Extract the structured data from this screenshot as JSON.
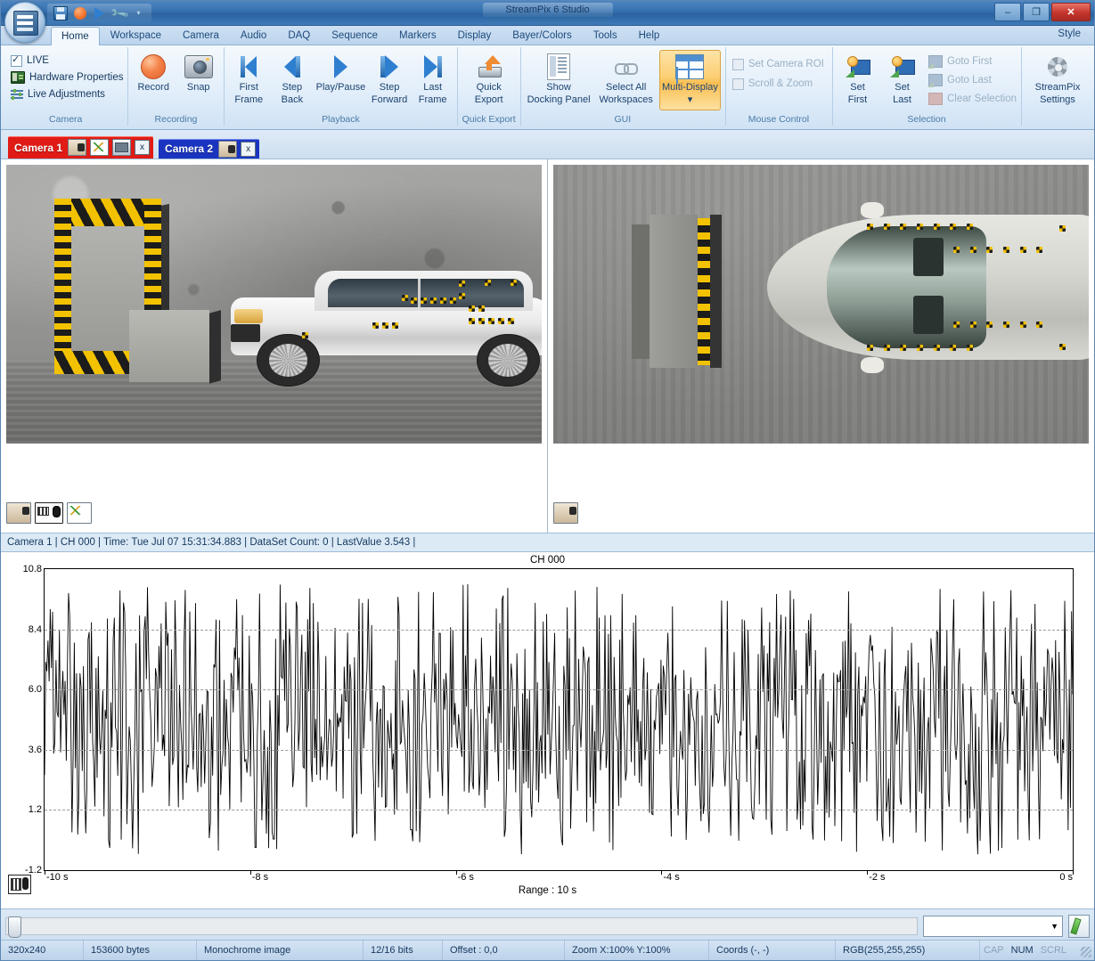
{
  "window": {
    "title": "StreamPix 6 Studio",
    "minimize": "–",
    "maximize": "❐",
    "close": "✕"
  },
  "quick_access": {
    "buttons": [
      {
        "name": "save-icon",
        "glyph": ""
      },
      {
        "name": "record-icon",
        "glyph": ""
      },
      {
        "name": "play-icon",
        "glyph": ""
      },
      {
        "name": "tools-icon",
        "glyph": ""
      },
      {
        "name": "customize-qat-icon",
        "glyph": "▾"
      }
    ]
  },
  "ribbon_tabs": {
    "items": [
      "Home",
      "Workspace",
      "Camera",
      "Audio",
      "DAQ",
      "Sequence",
      "Markers",
      "Display",
      "Bayer/Colors",
      "Tools",
      "Help"
    ],
    "active": "Home",
    "style_label": "Style",
    "style_caret": "▾"
  },
  "ribbon": {
    "groups": [
      {
        "title": "Camera",
        "checks": [
          {
            "label": "LIVE",
            "checked": true,
            "icon": "checkbox"
          },
          {
            "label": "Hardware Properties",
            "checked": false,
            "icon": "hardware-icon"
          },
          {
            "label": "Live Adjustments",
            "checked": false,
            "icon": "adjustments-icon"
          }
        ]
      },
      {
        "title": "Recording",
        "buttons": [
          {
            "label": "Record",
            "icon": "record-circle-icon",
            "active": false,
            "disabled": false
          },
          {
            "label": "Snap",
            "icon": "camera-icon",
            "active": false,
            "disabled": false
          }
        ]
      },
      {
        "title": "Playback",
        "buttons": [
          {
            "label": "First\nFrame",
            "line1": "First",
            "line2": "Frame",
            "icon": "first-frame-icon"
          },
          {
            "label": "Step Back",
            "line1": "Step",
            "line2": "Back",
            "icon": "step-back-icon"
          },
          {
            "label": "Play/Pause",
            "line1": "Play/Pause",
            "line2": "",
            "icon": "play-pause-icon"
          },
          {
            "label": "Step Forward",
            "line1": "Step",
            "line2": "Forward",
            "icon": "step-forward-icon"
          },
          {
            "label": "Last Frame",
            "line1": "Last",
            "line2": "Frame",
            "icon": "last-frame-icon"
          }
        ]
      },
      {
        "title": "Quick Export",
        "buttons": [
          {
            "line1": "Quick",
            "line2": "Export",
            "icon": "export-icon"
          }
        ]
      },
      {
        "title": "GUI",
        "buttons": [
          {
            "line1": "Show",
            "line2": "Docking Panel",
            "icon": "docking-panel-icon"
          },
          {
            "line1": "Select All",
            "line2": "Workspaces",
            "icon": "link-icon"
          },
          {
            "line1": "Multi-Display",
            "line2": "▾",
            "icon": "multi-display-icon",
            "active": true
          }
        ]
      },
      {
        "title": "Mouse Control",
        "checks": [
          {
            "label": "Set Camera ROI",
            "checked": false,
            "disabled": true
          },
          {
            "label": "Scroll & Zoom",
            "checked": false,
            "disabled": true
          }
        ]
      },
      {
        "title": "Selection",
        "buttons": [
          {
            "line1": "Set",
            "line2": "First",
            "icon": "set-first-icon"
          },
          {
            "line1": "Set",
            "line2": "Last",
            "icon": "set-last-icon"
          }
        ],
        "checks": [
          {
            "label": "Goto First",
            "disabled": true,
            "icon": "goto-first-icon"
          },
          {
            "label": "Goto Last",
            "disabled": true,
            "icon": "goto-last-icon"
          },
          {
            "label": "Clear Selection",
            "disabled": true,
            "icon": "clear-selection-icon"
          }
        ]
      },
      {
        "title": "",
        "buttons": [
          {
            "line1": "StreamPix",
            "line2": "Settings",
            "icon": "settings-wrench-icon"
          }
        ]
      }
    ]
  },
  "camera_tabs": [
    {
      "label": "Camera 1",
      "active": true,
      "color": "#e01b15",
      "icons": [
        "camera-icon",
        "graph-icon",
        "display-icon"
      ],
      "close": "x"
    },
    {
      "label": "Camera 2",
      "active": false,
      "color": "#1a34c0",
      "icons": [
        "camera-icon"
      ],
      "close": "x"
    }
  ],
  "video_panels": [
    {
      "name": "camera-1-view",
      "scene": "crash-test-side-view",
      "icons": [
        "camera-icon",
        "keyboard-mouse-icon",
        "graph-icon"
      ]
    },
    {
      "name": "camera-2-view",
      "scene": "crash-test-top-view",
      "icons": [
        "camera-icon"
      ]
    }
  ],
  "info_bar": {
    "text": "Camera 1 | CH 000 | Time: Tue Jul 07 15:31:34.883 | DataSet Count: 0 | LastValue 3.543 |"
  },
  "chart_data": {
    "type": "line",
    "title": "CH 000",
    "xlabel": "Range : 10 s",
    "ylabel": "",
    "x": [
      -10,
      -8,
      -6,
      -4,
      -2,
      0
    ],
    "xticklabels": [
      "-10 s",
      "-8 s",
      "-6 s",
      "-4 s",
      "-2 s",
      "0 s"
    ],
    "xlim": [
      -10,
      0
    ],
    "yticklabels": [
      "10.8",
      "8.4",
      "6.0",
      "3.6",
      "1.2",
      "-1.2"
    ],
    "yticks": [
      10.8,
      8.4,
      6.0,
      3.6,
      1.2,
      -1.2
    ],
    "ylim": [
      -1.2,
      10.8
    ],
    "grid": true,
    "gridlines_at": [
      8.4,
      6.0,
      3.6,
      1.2
    ],
    "legend": "none",
    "series": [
      {
        "name": "CH 000",
        "color": "#000000",
        "description": "High-frequency random noise, amplitude range approx -0.6 to 10.2, mean near 4.6, ~900 samples over 10 seconds",
        "sample_count": 900,
        "min": -0.6,
        "max": 10.2,
        "mean": 4.6,
        "last_value": 3.543
      }
    ]
  },
  "bottom_controls": {
    "slider": {
      "name": "frame-slider",
      "value": 0
    },
    "combo": {
      "value": "",
      "placeholder": "",
      "caret": "▼"
    },
    "edit_button": {
      "name": "edit-pencil-button"
    }
  },
  "status_bar": {
    "cells": [
      "320x240",
      "153600 bytes",
      "Monochrome image",
      "12/16 bits",
      "Offset : 0,0",
      "Zoom X:100%  Y:100%",
      "Coords (-, -)",
      "RGB(255,255,255)"
    ],
    "indicators": [
      "CAP",
      "NUM",
      "SCRL"
    ]
  },
  "colors": {
    "accent": "#2f7fd0",
    "active_tab": "#e01b15",
    "secondary_tab": "#1a34c0",
    "ribbon_active": "#f9bf52"
  }
}
